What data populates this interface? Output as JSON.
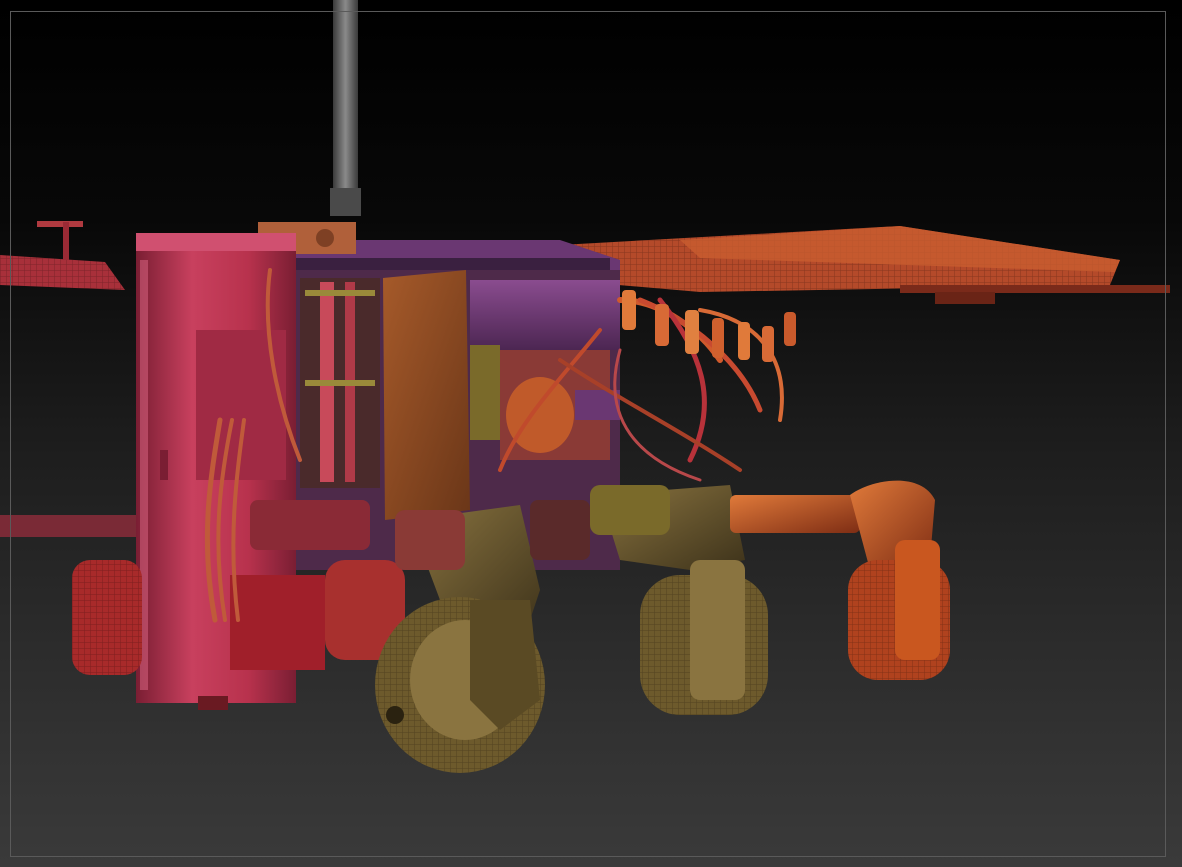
{
  "viewport": {
    "background_top": "#000000",
    "background_bottom": "#3a3a3a",
    "frame_color": "#5a5a5a"
  },
  "model": {
    "colors": {
      "magenta": "#b8324d",
      "magenta_light": "#d04868",
      "magenta_dark": "#7a1e33",
      "red": "#b03525",
      "orange": "#c9571f",
      "orange_light": "#e07a3a",
      "orange_dark": "#7e2d14",
      "purple": "#6a3772",
      "purple_light": "#8a4c8f",
      "olive": "#6d5a2c",
      "olive_light": "#8a7440",
      "olive_dark": "#3d321a",
      "plate": "#8c4a22",
      "mast": "#5a5a5a"
    }
  }
}
